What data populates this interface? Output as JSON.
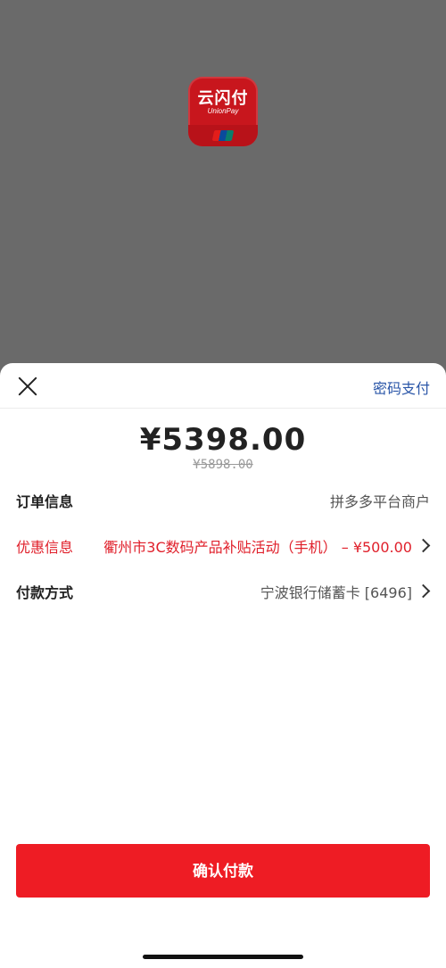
{
  "app_logo": {
    "title_cn": "云闪付",
    "title_en": "UnionPay"
  },
  "header": {
    "password_pay_label": "密码支付"
  },
  "payment": {
    "amount": "¥5398.00",
    "original_amount": "¥5898.00"
  },
  "rows": {
    "order": {
      "label": "订单信息",
      "value": "拼多多平台商户"
    },
    "promo": {
      "label": "优惠信息",
      "value": "衢州市3C数码产品补贴活动（手机） – ¥500.00"
    },
    "payment_method": {
      "label": "付款方式",
      "value": "宁波银行储蓄卡 [6496]"
    }
  },
  "confirm_button": {
    "label": "确认付款"
  },
  "colors": {
    "accent_red": "#ee1c24",
    "link_blue": "#2a56a8",
    "promo_red": "#e0202b"
  },
  "icons": [
    "close-icon",
    "chevron-right-icon",
    "unionpay-logo-icon"
  ]
}
